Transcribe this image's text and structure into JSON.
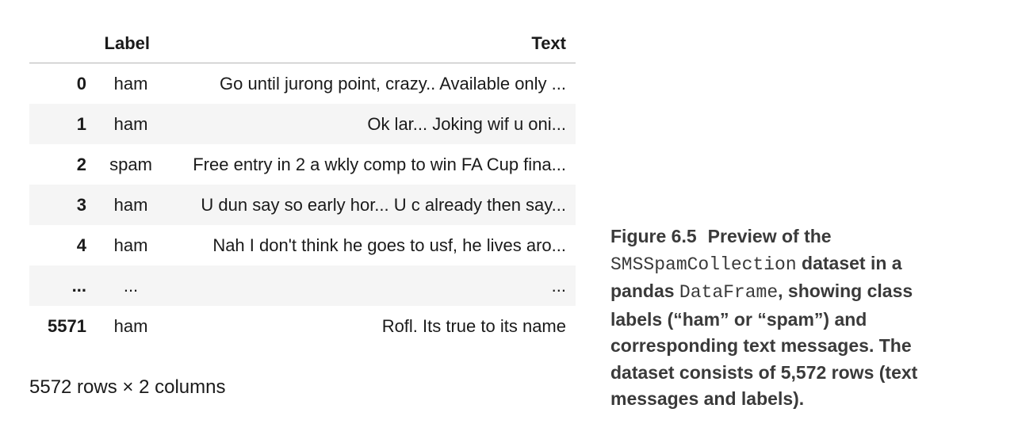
{
  "table": {
    "columns": [
      "",
      "Label",
      "Text"
    ],
    "rows": [
      {
        "index": "0",
        "label": "ham",
        "text": "Go until jurong point, crazy.. Available only ..."
      },
      {
        "index": "1",
        "label": "ham",
        "text": "Ok lar... Joking wif u oni..."
      },
      {
        "index": "2",
        "label": "spam",
        "text": "Free entry in 2 a wkly comp to win FA Cup fina..."
      },
      {
        "index": "3",
        "label": "ham",
        "text": "U dun say so early hor... U c already then say..."
      },
      {
        "index": "4",
        "label": "ham",
        "text": "Nah I don't think he goes to usf, he lives aro..."
      },
      {
        "index": "...",
        "label": "...",
        "text": "..."
      },
      {
        "index": "5571",
        "label": "ham",
        "text": "Rofl. Its true to its name"
      }
    ],
    "shape_text": "5572 rows × 2 columns"
  },
  "caption": {
    "figure_number": "Figure 6.5",
    "part1": "Preview of the ",
    "code1": "SMSSpamCollection",
    "part2": " dataset in a pandas ",
    "code2": "DataFrame",
    "part3": ", showing class labels (“ham” or “spam”) and corresponding text messages. The dataset consists of 5,572 rows (text messages and labels)."
  }
}
